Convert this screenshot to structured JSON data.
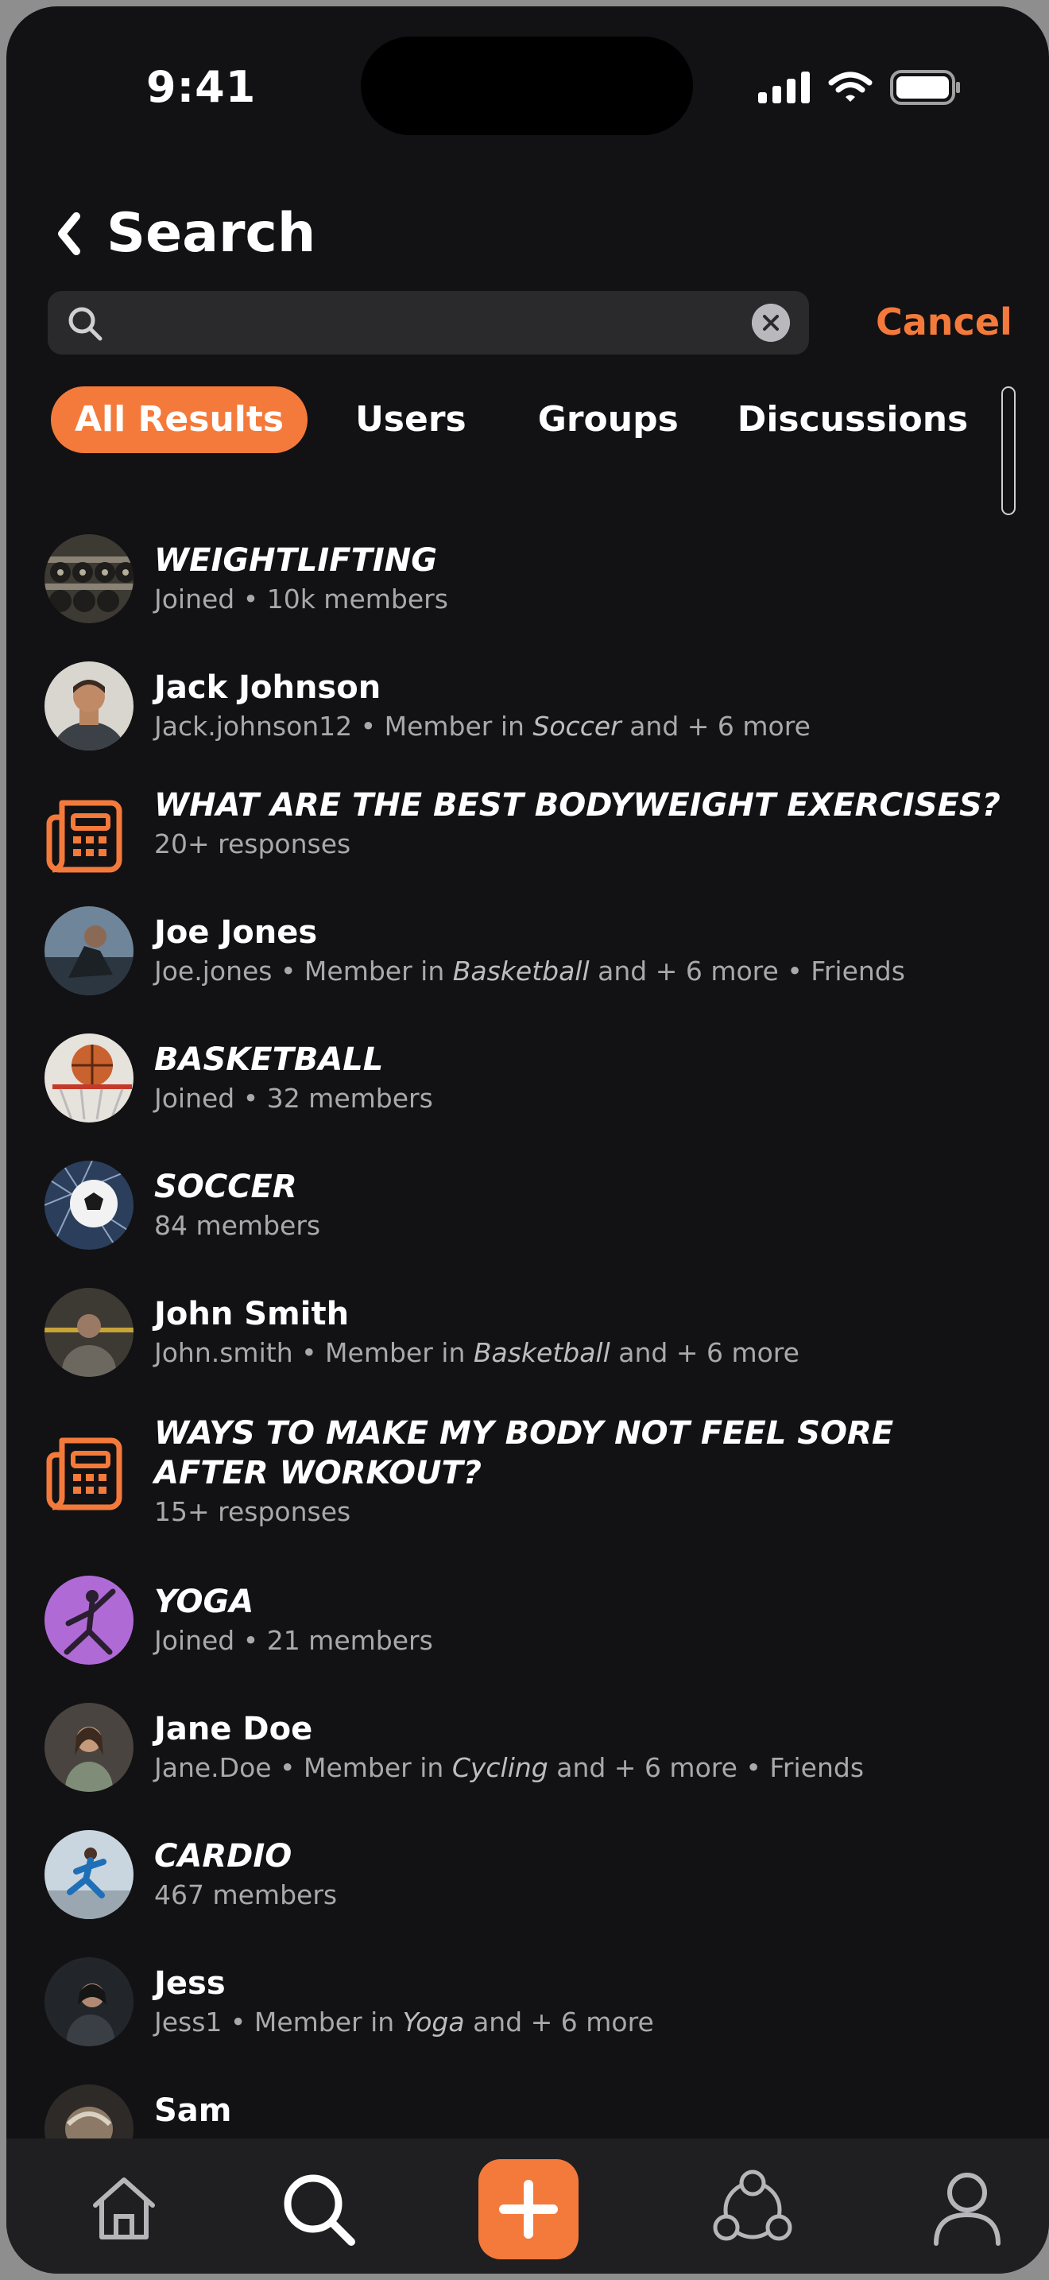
{
  "status_bar": {
    "time": "9:41"
  },
  "header": {
    "title": "Search"
  },
  "search": {
    "value": "",
    "placeholder": "",
    "cancel_label": "Cancel"
  },
  "tabs": [
    "All Results",
    "Users",
    "Groups",
    "Discussions"
  ],
  "results": [
    {
      "type": "group",
      "name": "WEIGHTLIFTING",
      "sub": "Joined • 10k members"
    },
    {
      "type": "user",
      "name": "Jack Johnson",
      "sub_pre": "Jack.johnson12 • Member in ",
      "sub_em": "Soccer",
      "sub_post": " and + 6 more"
    },
    {
      "type": "discussion",
      "name": "WHAT ARE THE BEST BODYWEIGHT EXERCISES?",
      "sub": "20+ responses"
    },
    {
      "type": "user",
      "name": "Joe Jones",
      "sub_pre": "Joe.jones • Member in ",
      "sub_em": "Basketball",
      "sub_post": " and + 6 more • Friends"
    },
    {
      "type": "group",
      "name": "BASKETBALL",
      "sub": "Joined • 32 members"
    },
    {
      "type": "group",
      "name": "SOCCER",
      "sub": "84 members"
    },
    {
      "type": "user",
      "name": "John Smith",
      "sub_pre": "John.smith • Member in ",
      "sub_em": "Basketball",
      "sub_post": " and + 6 more"
    },
    {
      "type": "discussion",
      "name": "WAYS TO MAKE MY BODY NOT FEEL SORE AFTER WORKOUT?",
      "sub": "15+ responses"
    },
    {
      "type": "group",
      "name": "YOGA",
      "sub": "Joined • 21 members"
    },
    {
      "type": "user",
      "name": "Jane Doe",
      "sub_pre": "Jane.Doe • Member in ",
      "sub_em": "Cycling",
      "sub_post": " and + 6 more • Friends"
    },
    {
      "type": "group",
      "name": "CARDIO",
      "sub": "467 members"
    },
    {
      "type": "user",
      "name": "Jess",
      "sub_pre": "Jess1 • Member in ",
      "sub_em": "Yoga",
      "sub_post": " and + 6 more"
    },
    {
      "type": "user",
      "name": "Sam",
      "sub_pre": "",
      "sub_em": "",
      "sub_post": ""
    }
  ],
  "nav": [
    "home-icon",
    "search-icon",
    "plus-icon",
    "community-icon",
    "profile-icon"
  ],
  "colors": {
    "accent": "#f47a3b",
    "background": "#121214",
    "tabbar": "#1f1f22",
    "muted_text": "#a9a9ad"
  }
}
